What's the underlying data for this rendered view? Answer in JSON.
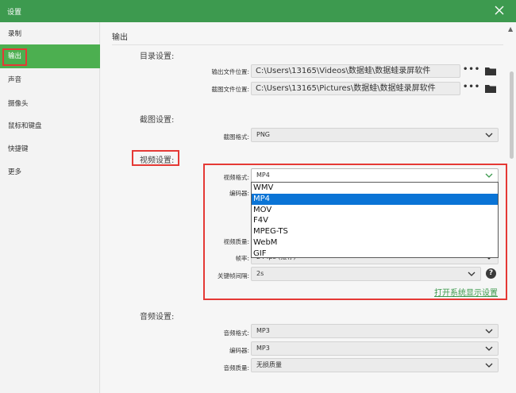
{
  "window": {
    "title": "设置"
  },
  "sidebar": {
    "items": [
      {
        "label": "录制"
      },
      {
        "label": "输出"
      },
      {
        "label": "声音"
      },
      {
        "label": "摄像头"
      },
      {
        "label": "鼠标和键盘"
      },
      {
        "label": "快捷键"
      },
      {
        "label": "更多"
      }
    ],
    "active": "输出"
  },
  "main": {
    "section_title": "输出",
    "directory": {
      "title": "目录设置:",
      "output_label": "输出文件位置:",
      "output_path": "C:\\Users\\13165\\Videos\\数据蛙\\数据蛙录屏软件",
      "screenshot_label": "截图文件位置:",
      "screenshot_path": "C:\\Users\\13165\\Pictures\\数据蛙\\数据蛙录屏软件",
      "dots": "•••"
    },
    "screenshot": {
      "title": "截图设置:",
      "format_label": "截图格式:",
      "format_value": "PNG"
    },
    "video": {
      "title": "视频设置:",
      "format_label": "视频格式:",
      "format_value": "MP4",
      "encoder_label": "编码器:",
      "quality_label": "视频质量:",
      "framerate_label": "帧率:",
      "framerate_value": "24 fps (推荐)",
      "keyframe_label": "关键帧间隔:",
      "keyframe_value": "2s",
      "help": "?",
      "open_display_link": "打开系统显示设置",
      "format_options": [
        "WMV",
        "MP4",
        "MOV",
        "F4V",
        "MPEG-TS",
        "WebM",
        "GIF"
      ],
      "selected_option": "MP4"
    },
    "audio": {
      "title": "音频设置:",
      "format_label": "音频格式:",
      "format_value": "MP3",
      "encoder_label": "编码器:",
      "encoder_value": "MP3",
      "quality_label": "音频质量:",
      "quality_value": "无损质量"
    }
  },
  "colors": {
    "accent": "#3d9a4f",
    "active_item": "#4caf50",
    "highlight_box": "#e53935",
    "selection": "#0a74d6",
    "link": "#3e9b4f"
  }
}
